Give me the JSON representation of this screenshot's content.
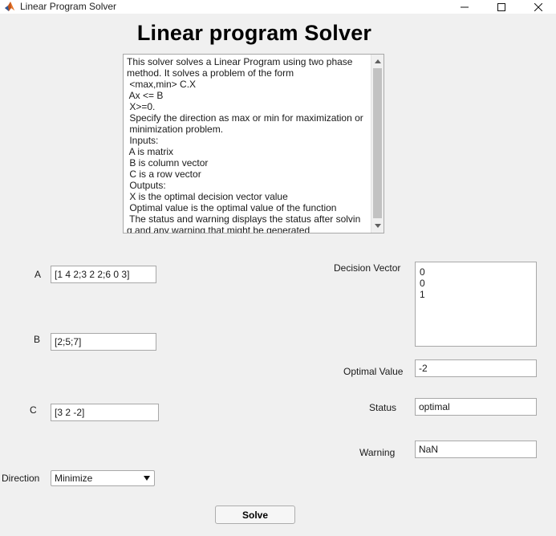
{
  "window": {
    "title": "Linear Program Solver"
  },
  "page": {
    "heading": "Linear program Solver"
  },
  "description": {
    "lines": [
      "This solver solves a Linear Program using two phase",
      "method. It solves a problem of the form",
      " <max,min> C.X",
      " Ax <= B",
      " X>=0.",
      " Specify the direction as max or min for maximization or",
      " minimization problem.",
      " Inputs:",
      " A is matrix",
      " B is column vector",
      " C is a row vector",
      " Outputs:",
      " X is the optimal decision vector value",
      " Optimal value is the optimal value of the function",
      " The status and warning displays the status after solvin",
      "g and any warning that might be generated"
    ]
  },
  "inputs": {
    "a": {
      "label": "A",
      "value": "[1 4 2;3 2 2;6 0 3]"
    },
    "b": {
      "label": "B",
      "value": "[2;5;7]"
    },
    "c": {
      "label": "C",
      "value": "[3 2 -2]"
    },
    "direction": {
      "label": "Direction",
      "selected": "Minimize"
    }
  },
  "outputs": {
    "decision_vector": {
      "label": "Decision Vector",
      "values": [
        "0",
        "0",
        "1"
      ]
    },
    "optimal_value": {
      "label": "Optimal Value",
      "value": "-2"
    },
    "status": {
      "label": "Status",
      "value": "optimal"
    },
    "warning": {
      "label": "Warning",
      "value": "NaN"
    }
  },
  "actions": {
    "solve_label": "Solve"
  },
  "icons": {
    "app": "matlab-icon",
    "minimize": "minimize-icon",
    "maximize": "maximize-icon",
    "close": "close-icon",
    "dropdown": "chevron-down-icon",
    "scroll_up": "scroll-up-icon",
    "scroll_down": "scroll-down-icon"
  }
}
